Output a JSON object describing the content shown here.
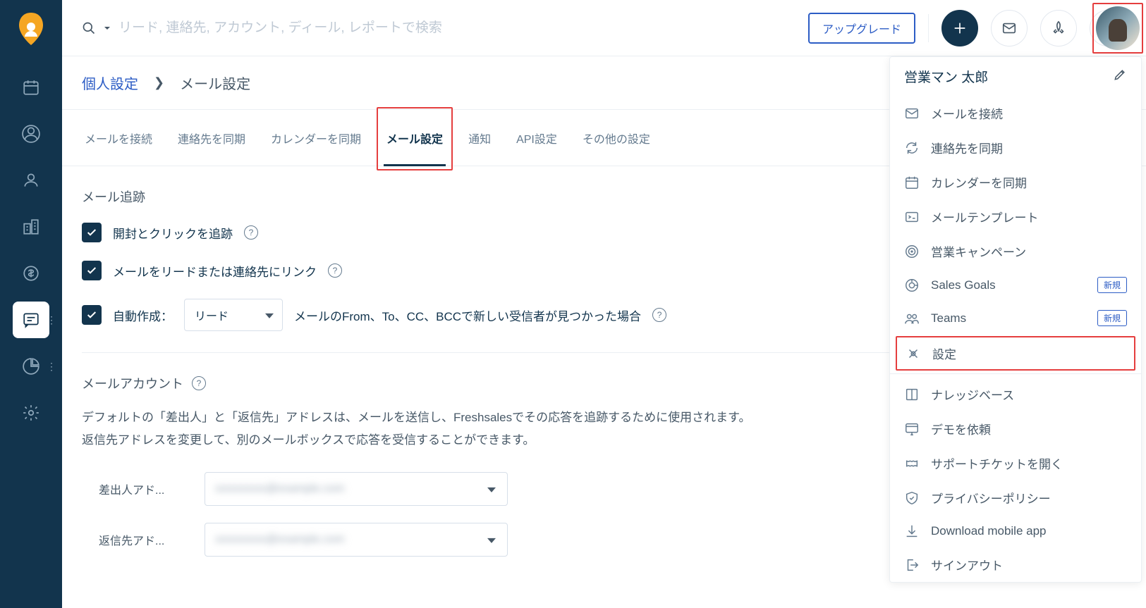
{
  "search": {
    "placeholder": "リード, 連絡先, アカウント, ディール, レポートで検索"
  },
  "topbar": {
    "upgrade": "アップグレード"
  },
  "breadcrumb": {
    "parent": "個人設定",
    "current": "メール設定"
  },
  "tabs": [
    {
      "label": "メールを接続"
    },
    {
      "label": "連絡先を同期"
    },
    {
      "label": "カレンダーを同期"
    },
    {
      "label": "メール設定"
    },
    {
      "label": "通知"
    },
    {
      "label": "API設定"
    },
    {
      "label": "その他の設定"
    }
  ],
  "tracking": {
    "title": "メール追跡",
    "check1": "開封とクリックを追跡",
    "check2": "メールをリードまたは連絡先にリンク",
    "check3_prefix": "自動作成：",
    "check3_select": "リード",
    "check3_suffix": "メールのFrom、To、CC、BCCで新しい受信者が見つかった場合"
  },
  "account": {
    "title": "メールアカウント",
    "desc": "デフォルトの「差出人」と「返信先」アドレスは、メールを送信し、Freshsalesでその応答を追跡するために使用されます。返信先アドレスを変更して、別のメールボックスで応答を受信することができます。",
    "from_label": "差出人アド...",
    "from_value": "xxxxxxxxx@example.com",
    "reply_label": "返信先アド...",
    "reply_value": "xxxxxxxxx@example.com"
  },
  "profile": {
    "name": "営業マン 太郎",
    "items": [
      {
        "label": "メールを接続",
        "icon": "mail"
      },
      {
        "label": "連絡先を同期",
        "icon": "sync"
      },
      {
        "label": "カレンダーを同期",
        "icon": "calendar"
      },
      {
        "label": "メールテンプレート",
        "icon": "template"
      },
      {
        "label": "営業キャンペーン",
        "icon": "target"
      },
      {
        "label": "Sales Goals",
        "icon": "goal",
        "badge": "新規"
      },
      {
        "label": "Teams",
        "icon": "team",
        "badge": "新規"
      },
      {
        "label": "設定",
        "icon": "settings",
        "highlighted": true
      },
      {
        "label": "ナレッジベース",
        "icon": "book"
      },
      {
        "label": "デモを依頼",
        "icon": "demo"
      },
      {
        "label": "サポートチケットを開く",
        "icon": "ticket"
      },
      {
        "label": "プライバシーポリシー",
        "icon": "shield"
      },
      {
        "label": "Download mobile app",
        "icon": "download"
      },
      {
        "label": "サインアウト",
        "icon": "signout"
      }
    ]
  }
}
